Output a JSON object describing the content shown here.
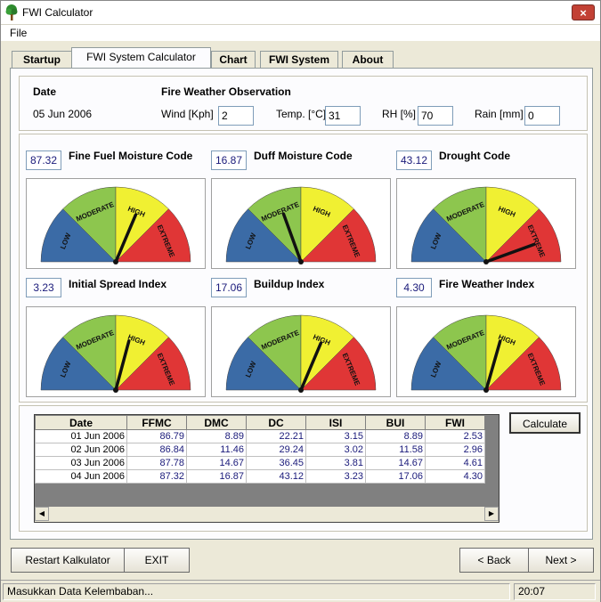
{
  "window": {
    "title": "FWI Calculator",
    "close_glyph": "×"
  },
  "menu": {
    "file": "File"
  },
  "tabs": [
    {
      "label": "Startup"
    },
    {
      "label": "FWI System Calculator",
      "active": true
    },
    {
      "label": "Chart"
    },
    {
      "label": "FWI System"
    },
    {
      "label": "About"
    }
  ],
  "observation": {
    "date_label": "Date",
    "date_value": "05 Jun 2006",
    "heading": "Fire Weather Observation",
    "wind_label": "Wind [Kph]",
    "wind_value": "2",
    "temp_label": "Temp. [°C]",
    "temp_value": "31",
    "rh_label": "RH [%]",
    "rh_value": "70",
    "rain_label": "Rain [mm]",
    "rain_value": "0"
  },
  "gauge_labels": {
    "low": "LOW",
    "moderate": "MODERATE",
    "high": "HIGH",
    "extreme": "EXTREME"
  },
  "gauge_colors": {
    "low": "#3b6ba6",
    "moderate": "#8dc64e",
    "high": "#f0f032",
    "extreme": "#e03636"
  },
  "gauges": [
    {
      "value": "87.32",
      "label": "Fine Fuel Moisture Code",
      "needle_deg": 67
    },
    {
      "value": "16.87",
      "label": "Duff Moisture Code",
      "needle_deg": 110
    },
    {
      "value": "43.12",
      "label": "Drought Code",
      "needle_deg": 20
    },
    {
      "value": "3.23",
      "label": "Initial Spread Index",
      "needle_deg": 75
    },
    {
      "value": "17.06",
      "label": "Buildup Index",
      "needle_deg": 67
    },
    {
      "value": "4.30",
      "label": "Fire Weather Index",
      "needle_deg": 74
    }
  ],
  "table": {
    "headers": [
      "Date",
      "FFMC",
      "DMC",
      "DC",
      "ISI",
      "BUI",
      "FWI"
    ],
    "rows": [
      [
        "01 Jun 2006",
        "86.79",
        "8.89",
        "22.21",
        "3.15",
        "8.89",
        "2.53"
      ],
      [
        "02 Jun 2006",
        "86.84",
        "11.46",
        "29.24",
        "3.02",
        "11.58",
        "2.96"
      ],
      [
        "03 Jun 2006",
        "87.78",
        "14.67",
        "36.45",
        "3.81",
        "14.67",
        "4.61"
      ],
      [
        "04 Jun 2006",
        "87.32",
        "16.87",
        "43.12",
        "3.23",
        "17.06",
        "4.30"
      ]
    ]
  },
  "buttons": {
    "calculate": "Calculate",
    "restart": "Restart Kalkulator",
    "exit": "EXIT",
    "back": "< Back",
    "next": "Next >"
  },
  "status": {
    "message": "Masukkan Data Kelembaban...",
    "time": "20:07"
  }
}
